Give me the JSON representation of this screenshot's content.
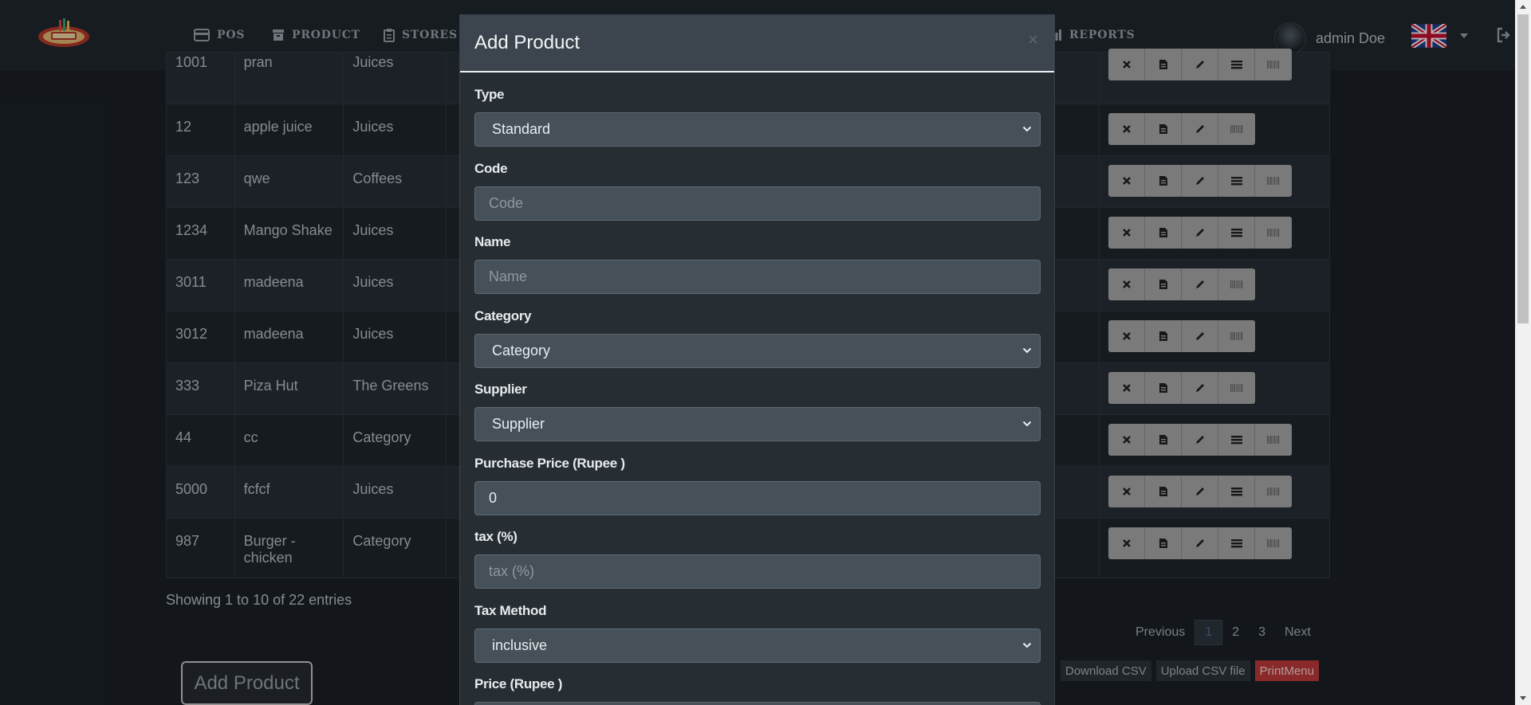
{
  "nav": {
    "items": [
      {
        "label": "POS",
        "icon": "credit-card-icon"
      },
      {
        "label": "PRODUCT",
        "icon": "archive-icon"
      },
      {
        "label": "STORES",
        "icon": "clipboard-icon"
      },
      {
        "label": "REPORTS",
        "icon": "chart-icon"
      }
    ],
    "user_name": "admin Doe"
  },
  "table": {
    "rows": [
      {
        "code": "1001",
        "name": "pran",
        "category": "Juices",
        "actions": 5
      },
      {
        "code": "12",
        "name": "apple juice",
        "category": "Juices",
        "actions": 4
      },
      {
        "code": "123",
        "name": "qwe",
        "category": "Coffees",
        "actions": 5
      },
      {
        "code": "1234",
        "name": "Mango Shake",
        "category": "Juices",
        "actions": 5
      },
      {
        "code": "3011",
        "name": "madeena",
        "category": "Juices",
        "actions": 4
      },
      {
        "code": "3012",
        "name": "madeena",
        "category": "Juices",
        "actions": 4
      },
      {
        "code": "333",
        "name": "Piza Hut",
        "category": "The Greens",
        "actions": 4
      },
      {
        "code": "44",
        "name": "cc",
        "category": "Category",
        "actions": 5
      },
      {
        "code": "5000",
        "name": "fcfcf",
        "category": "Juices",
        "actions": 5
      },
      {
        "code": "987",
        "name": "Burger - chicken",
        "category": "Category",
        "actions": 5
      }
    ],
    "showing": "Showing 1 to 10 of 22 entries"
  },
  "pagination": {
    "previous": "Previous",
    "pages": [
      "1",
      "2",
      "3"
    ],
    "next": "Next"
  },
  "buttons": {
    "add_product": "Add Product",
    "download_csv": "Download CSV",
    "upload_csv": "Upload CSV file",
    "print_menu": "PrintMenu"
  },
  "modal": {
    "title": "Add Product",
    "close": "×",
    "fields": {
      "type": {
        "label": "Type",
        "value": "Standard"
      },
      "code": {
        "label": "Code",
        "placeholder": "Code"
      },
      "name": {
        "label": "Name",
        "placeholder": "Name"
      },
      "category": {
        "label": "Category",
        "value": "Category"
      },
      "supplier": {
        "label": "Supplier",
        "value": "Supplier"
      },
      "purchase_price": {
        "label": "Purchase Price (Rupee )",
        "value": "0"
      },
      "tax": {
        "label": "tax (%)",
        "placeholder": "tax (%)"
      },
      "tax_method": {
        "label": "Tax Method",
        "value": "inclusive"
      },
      "price": {
        "label": "Price (Rupee )"
      }
    }
  },
  "colors": {
    "accent": "#c0393b",
    "background": "#1b2127",
    "navbar": "#20272e",
    "modal": "#262d33",
    "input": "#455058"
  }
}
